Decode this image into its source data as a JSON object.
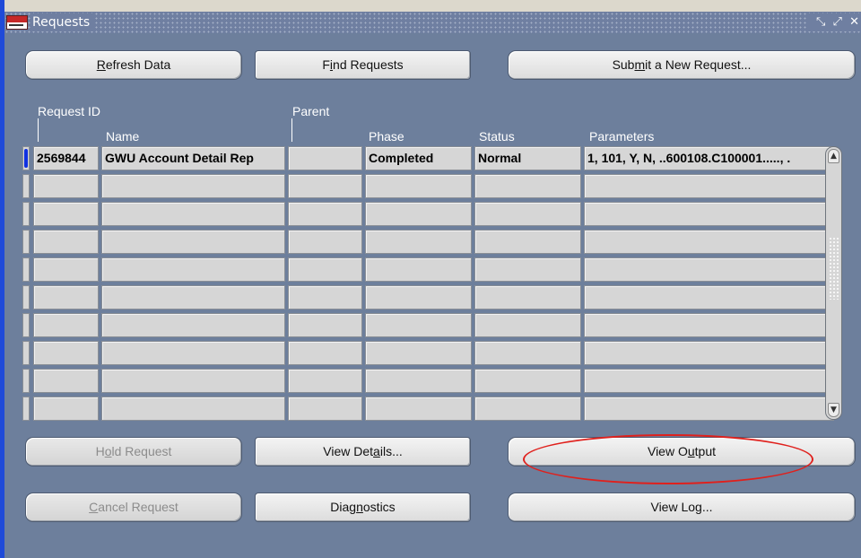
{
  "window": {
    "title": "Requests",
    "controls": [
      "⤡",
      "⤢",
      "✕"
    ]
  },
  "buttons": {
    "refresh": {
      "pre": "",
      "key": "R",
      "post": "efresh Data"
    },
    "find": {
      "pre": "F",
      "key": "i",
      "post": "nd Requests"
    },
    "submit": {
      "pre": "Sub",
      "key": "m",
      "post": "it a New Request..."
    },
    "hold": {
      "pre": "H",
      "key": "o",
      "post": "ld Request"
    },
    "view_details": {
      "pre": "View Det",
      "key": "a",
      "post": "ils..."
    },
    "view_output": {
      "pre": "View O",
      "key": "u",
      "post": "tput"
    },
    "cancel": {
      "pre": "",
      "key": "C",
      "post": "ancel Request"
    },
    "diagnostics": {
      "pre": "Diag",
      "key": "n",
      "post": "ostics"
    },
    "view_log": {
      "pre": "View Lo",
      "key": "g",
      "post": "..."
    }
  },
  "columns": {
    "request_id": "Request ID",
    "name": "Name",
    "parent": "Parent",
    "phase": "Phase",
    "status": "Status",
    "parameters": "Parameters"
  },
  "rows": [
    {
      "request_id": "2569844",
      "name": "GWU Account Detail Rep",
      "parent": "",
      "phase": "Completed",
      "status": "Normal",
      "parameters": "1, 101, Y, N, ..600108.C100001....., ."
    }
  ],
  "empty_row_count": 9,
  "colors": {
    "background": "#6d7f9c",
    "highlight_ellipse": "#e0201c",
    "active_indicator": "#1030e0"
  }
}
